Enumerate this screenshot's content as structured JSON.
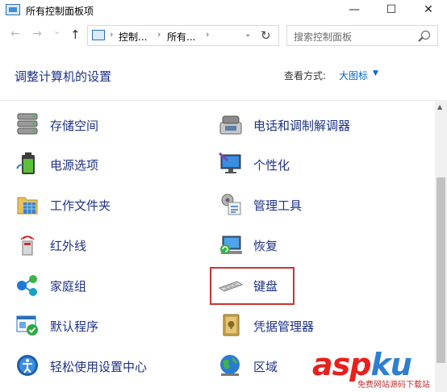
{
  "window": {
    "title": "所有控制面板项",
    "minimize": "—",
    "maximize": "☐",
    "close": "✕"
  },
  "nav": {
    "back": "←",
    "forward": "→",
    "history": "⌄",
    "up": "↑",
    "breadcrumbs": [
      "控制...",
      "所有..."
    ],
    "search_placeholder": "搜索控制面板"
  },
  "header": {
    "title": "调整计算机的设置",
    "view_by_label": "查看方式:",
    "view_by_value": "大图标"
  },
  "items": [
    {
      "label": "存储空间",
      "icon": "storage-spaces-icon"
    },
    {
      "label": "电话和调制解调器",
      "icon": "phone-modem-icon"
    },
    {
      "label": "电源选项",
      "icon": "power-options-icon"
    },
    {
      "label": "个性化",
      "icon": "personalization-icon"
    },
    {
      "label": "工作文件夹",
      "icon": "work-folders-icon"
    },
    {
      "label": "管理工具",
      "icon": "admin-tools-icon"
    },
    {
      "label": "红外线",
      "icon": "infrared-icon"
    },
    {
      "label": "恢复",
      "icon": "recovery-icon"
    },
    {
      "label": "家庭组",
      "icon": "homegroup-icon"
    },
    {
      "label": "键盘",
      "icon": "keyboard-icon"
    },
    {
      "label": "默认程序",
      "icon": "default-programs-icon"
    },
    {
      "label": "凭据管理器",
      "icon": "credential-manager-icon"
    },
    {
      "label": "轻松使用设置中心",
      "icon": "ease-of-access-icon"
    },
    {
      "label": "区域",
      "icon": "region-icon"
    }
  ],
  "highlighted_item": "键盘",
  "watermark": {
    "text_left": "asp",
    "text_right": "ku",
    "sub": "免费网站源码下载站",
    "colors": {
      "left": "#e8201c",
      "right": "#2f7fd0"
    }
  }
}
